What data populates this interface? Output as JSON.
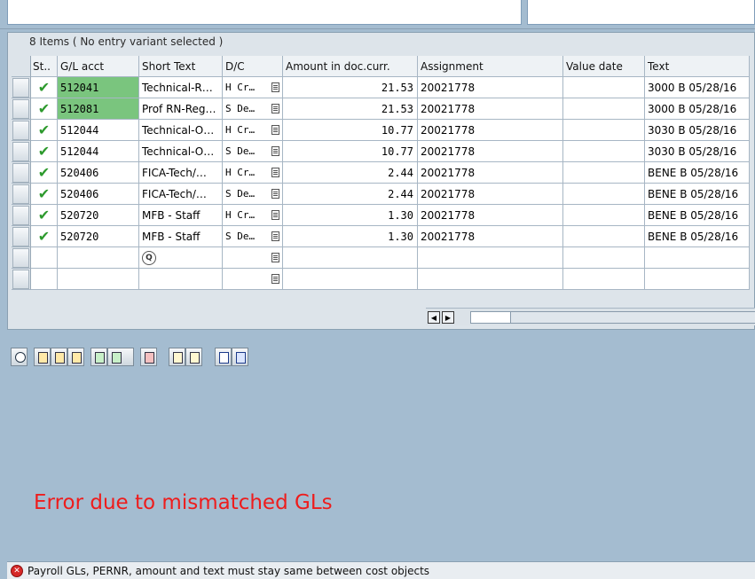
{
  "grid": {
    "title": "8 Items ( No entry variant selected )",
    "columns": {
      "status": "St..",
      "gl_acct": "G/L acct",
      "short_text": "Short Text",
      "dc": "D/C",
      "amount": "Amount in doc.curr.",
      "assignment": "Assignment",
      "value_date": "Value date",
      "text": "Text"
    },
    "rows": [
      {
        "gl": "512041",
        "short": "Technical-R…",
        "dc": "H Cr…",
        "amount": "21.53",
        "assignment": "20021778",
        "value_date": "",
        "text": "3000 B 05/28/16"
      },
      {
        "gl": "512081",
        "short": "Prof RN-Reg…",
        "dc": "S De…",
        "amount": "21.53",
        "assignment": "20021778",
        "value_date": "",
        "text": "3000 B 05/28/16"
      },
      {
        "gl": "512044",
        "short": "Technical-O…",
        "dc": "H Cr…",
        "amount": "10.77",
        "assignment": "20021778",
        "value_date": "",
        "text": "3030 B 05/28/16"
      },
      {
        "gl": "512044",
        "short": "Technical-O…",
        "dc": "S De…",
        "amount": "10.77",
        "assignment": "20021778",
        "value_date": "",
        "text": "3030 B 05/28/16"
      },
      {
        "gl": "520406",
        "short": "FICA-Tech/…",
        "dc": "H Cr…",
        "amount": "2.44",
        "assignment": "20021778",
        "value_date": "",
        "text": "BENE B 05/28/16"
      },
      {
        "gl": "520406",
        "short": "FICA-Tech/…",
        "dc": "S De…",
        "amount": "2.44",
        "assignment": "20021778",
        "value_date": "",
        "text": "BENE B 05/28/16"
      },
      {
        "gl": "520720",
        "short": "MFB - Staff",
        "dc": "H Cr…",
        "amount": "1.30",
        "assignment": "20021778",
        "value_date": "",
        "text": "BENE B 05/28/16"
      },
      {
        "gl": "520720",
        "short": "MFB - Staff",
        "dc": "S De…",
        "amount": "1.30",
        "assignment": "20021778",
        "value_date": "",
        "text": "BENE B 05/28/16"
      }
    ]
  },
  "icons": {
    "status_ok": "check-icon",
    "value_help": "magnifier-icon",
    "f4_help": "list-icon",
    "error": "error-icon"
  },
  "colors": {
    "highlight_gl": "#7ac57e",
    "error_text": "#ee1c1c",
    "background": "#a4bcd0"
  },
  "annotation": "Error due to mismatched GLs",
  "status_bar": {
    "message": "Payroll GLs, PERNR, amount and text must stay same between cost objects"
  }
}
